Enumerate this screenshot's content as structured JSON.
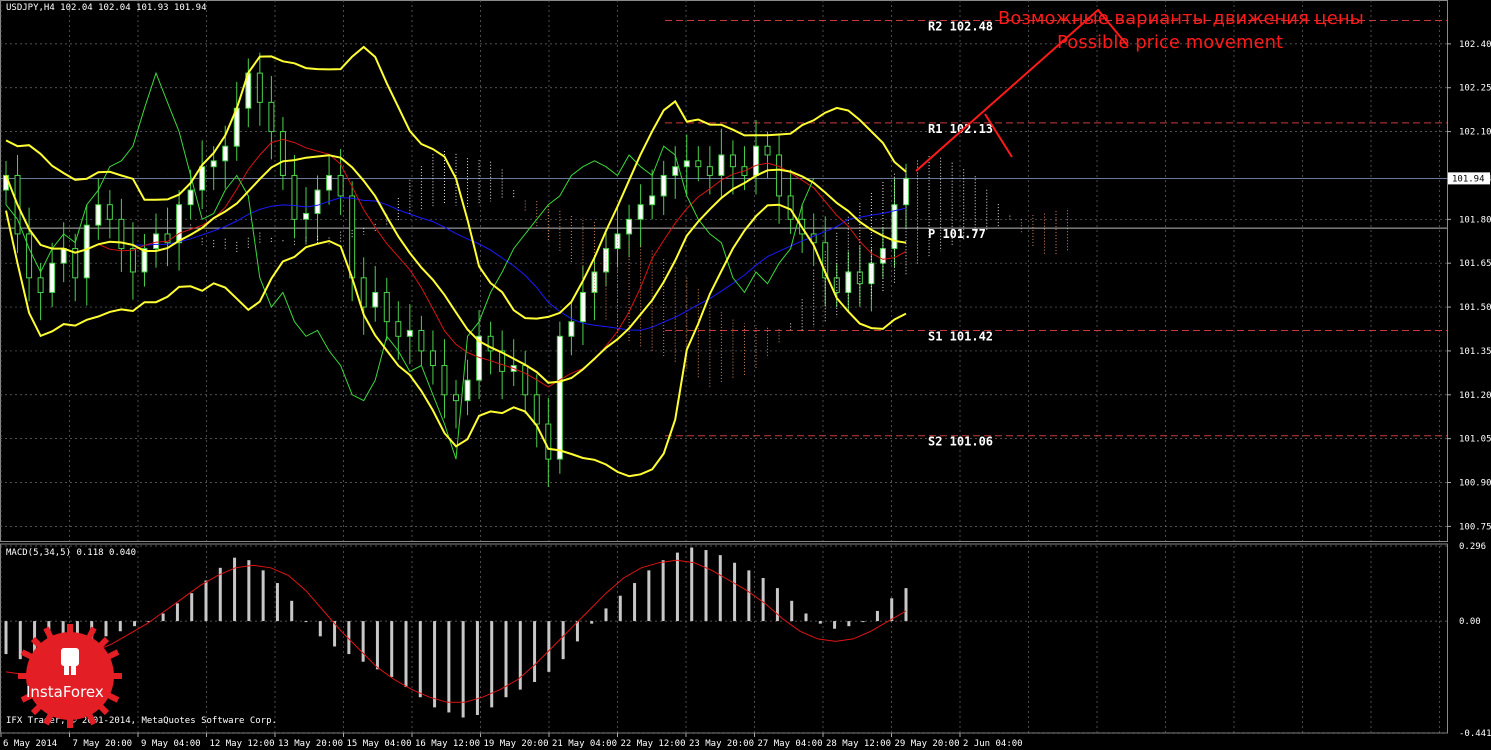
{
  "header": {
    "symbol_line": "USDJPY,H4  102.04 102.04 101.93 101.94"
  },
  "macd": {
    "label": "MACD(5,34,5) 0.118 0.040"
  },
  "footer": {
    "copyright": "IFX Trader, © 2001-2014, MetaQuotes Software Corp."
  },
  "annotation": {
    "russian": "Возможные варианты движения цены",
    "english": "Possible price movement"
  },
  "logo": {
    "text": "InstaForex"
  },
  "colors": {
    "background": "#000000",
    "grid": "#6b6b6b",
    "bollinger": "#ffff33",
    "candles": "#4cd24c",
    "kijun": "#1a1aff",
    "tenkan": "#d91414",
    "chikou": "#3ad83a",
    "cloud": "#d88a5a",
    "levels": "#c83a3a",
    "annotation": "#ff1a1a",
    "macd_hist": "#c8c8c8",
    "macd_signal": "#e01414"
  },
  "chart_data": [
    {
      "type": "candlestick",
      "title": "USDJPY,H4",
      "ylim": [
        100.7,
        102.55
      ],
      "y_ticks": [
        "102.40",
        "102.25",
        "102.10",
        "101.94",
        "101.80",
        "101.65",
        "101.50",
        "101.35",
        "101.20",
        "101.05",
        "100.90",
        "100.75"
      ],
      "x_tick_labels": [
        "6 May 2014",
        "7 May 20:00",
        "9 May 04:00",
        "12 May 12:00",
        "13 May 20:00",
        "15 May 04:00",
        "16 May 12:00",
        "19 May 20:00",
        "21 May 04:00",
        "22 May 12:00",
        "23 May 20:00",
        "27 May 04:00",
        "28 May 12:00",
        "29 May 20:00",
        "2 Jun 04:00"
      ],
      "current_price": 101.94,
      "pivot_levels": [
        {
          "label": "R2",
          "value": 102.48
        },
        {
          "label": "R1",
          "value": 102.13
        },
        {
          "label": "P",
          "value": 101.77
        },
        {
          "label": "S1",
          "value": 101.42
        },
        {
          "label": "S2",
          "value": 101.06
        }
      ],
      "close": [
        101.95,
        101.75,
        101.6,
        101.55,
        101.65,
        101.7,
        101.6,
        101.78,
        101.85,
        101.8,
        101.7,
        101.62,
        101.7,
        101.75,
        101.72,
        101.85,
        101.9,
        101.98,
        102.0,
        102.05,
        102.18,
        102.3,
        102.2,
        102.1,
        101.95,
        101.8,
        101.82,
        101.9,
        101.95,
        101.88,
        101.6,
        101.5,
        101.55,
        101.45,
        101.4,
        101.42,
        101.35,
        101.3,
        101.2,
        101.18,
        101.25,
        101.4,
        101.35,
        101.28,
        101.3,
        101.2,
        101.1,
        100.98,
        101.4,
        101.45,
        101.55,
        101.62,
        101.7,
        101.75,
        101.8,
        101.85,
        101.88,
        101.95,
        101.98,
        102.0,
        101.98,
        101.95,
        102.02,
        101.98,
        101.95,
        102.05,
        102.02,
        101.88,
        101.8,
        101.75,
        101.72,
        101.6,
        101.55,
        101.62,
        101.58,
        101.65,
        101.7,
        101.85,
        101.94
      ],
      "indicators": [
        "Bollinger Bands",
        "Ichimoku Kinko Hyo"
      ]
    },
    {
      "type": "bar",
      "title": "MACD(5,34,5) 0.118 0.040",
      "ylim": [
        -0.441,
        0.296
      ],
      "y_ticks": [
        "0.296",
        "0.00",
        "-0.441"
      ],
      "macd_value": 0.118,
      "signal_value": 0.04,
      "histogram": [
        -0.13,
        -0.15,
        -0.16,
        -0.14,
        -0.12,
        -0.1,
        -0.08,
        -0.06,
        -0.04,
        -0.02,
        0.0,
        0.03,
        0.07,
        0.11,
        0.16,
        0.21,
        0.25,
        0.24,
        0.2,
        0.15,
        0.08,
        0.0,
        -0.06,
        -0.1,
        -0.13,
        -0.16,
        -0.19,
        -0.22,
        -0.26,
        -0.3,
        -0.34,
        -0.36,
        -0.38,
        -0.37,
        -0.34,
        -0.3,
        -0.27,
        -0.24,
        -0.2,
        -0.15,
        -0.08,
        -0.01,
        0.05,
        0.1,
        0.15,
        0.2,
        0.24,
        0.27,
        0.29,
        0.28,
        0.26,
        0.23,
        0.2,
        0.17,
        0.13,
        0.08,
        0.03,
        -0.01,
        -0.03,
        -0.02,
        0.0,
        0.04,
        0.09,
        0.13
      ],
      "signal": [
        -0.2,
        -0.21,
        -0.2,
        -0.18,
        -0.15,
        -0.12,
        -0.09,
        -0.05,
        -0.01,
        0.04,
        0.09,
        0.14,
        0.18,
        0.21,
        0.22,
        0.21,
        0.18,
        0.12,
        0.04,
        -0.04,
        -0.11,
        -0.18,
        -0.23,
        -0.27,
        -0.3,
        -0.32,
        -0.32,
        -0.3,
        -0.27,
        -0.23,
        -0.17,
        -0.1,
        -0.03,
        0.04,
        0.11,
        0.17,
        0.21,
        0.23,
        0.24,
        0.23,
        0.2,
        0.16,
        0.12,
        0.07,
        0.01,
        -0.04,
        -0.07,
        -0.08,
        -0.07,
        -0.04,
        0.0,
        0.04
      ]
    }
  ]
}
